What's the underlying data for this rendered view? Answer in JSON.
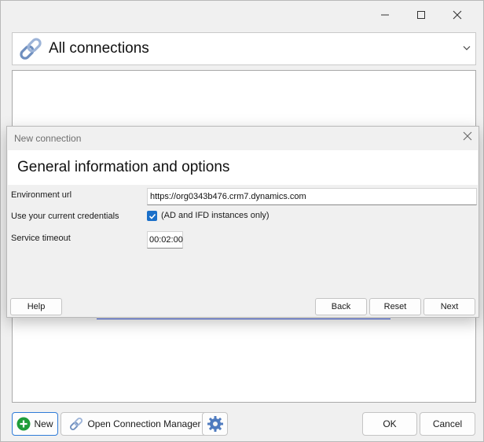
{
  "main": {
    "connection_selector": {
      "label": "All connections"
    }
  },
  "bottom_bar": {
    "new_label": "New",
    "open_manager_label": "Open Connection Manager",
    "ok_label": "OK",
    "cancel_label": "Cancel"
  },
  "dialog": {
    "title": "New connection",
    "heading": "General information and options",
    "fields": {
      "environment_url": {
        "label": "Environment url",
        "value": "https://org0343b476.crm7.dynamics.com"
      },
      "credentials": {
        "label": "Use your current credentials",
        "checked": true,
        "checkbox_text": "(AD and IFD instances only)"
      },
      "service_timeout": {
        "label": "Service timeout",
        "value": "00:02:00"
      }
    },
    "buttons": {
      "help": "Help",
      "back": "Back",
      "reset": "Reset",
      "next": "Next"
    }
  },
  "colors": {
    "accent": "#1a6fc9",
    "new_icon_green": "#1f9d3a",
    "link_blue": "#2a4bd7"
  },
  "icons": {
    "connection": "chain-link-icon",
    "new": "plus-circle-icon",
    "manager": "chain-link-icon",
    "settings": "gear-icon"
  }
}
